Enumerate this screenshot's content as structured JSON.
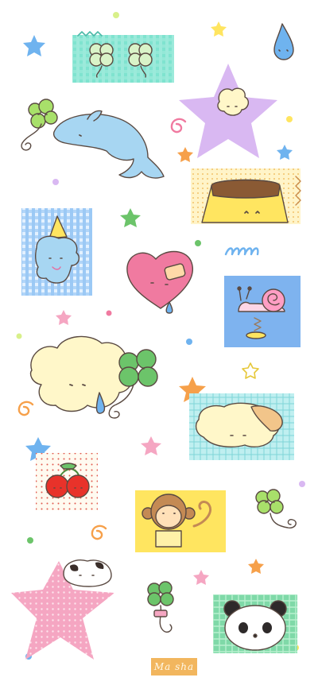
{
  "artwork": {
    "description_free": true,
    "signature_text": "Ma sha",
    "palette": {
      "outline": "#5a4a42",
      "cream": "#fff7c9",
      "pink": "#f07aa0",
      "sky": "#9ccfee",
      "mint": "#7fe3cf",
      "green": "#6cc46a",
      "yellow": "#ffe560",
      "lilac": "#d9b8f2",
      "orange": "#f6a04a",
      "blue_star": "#6fb3ef",
      "stamp": "#f2b65e"
    }
  }
}
